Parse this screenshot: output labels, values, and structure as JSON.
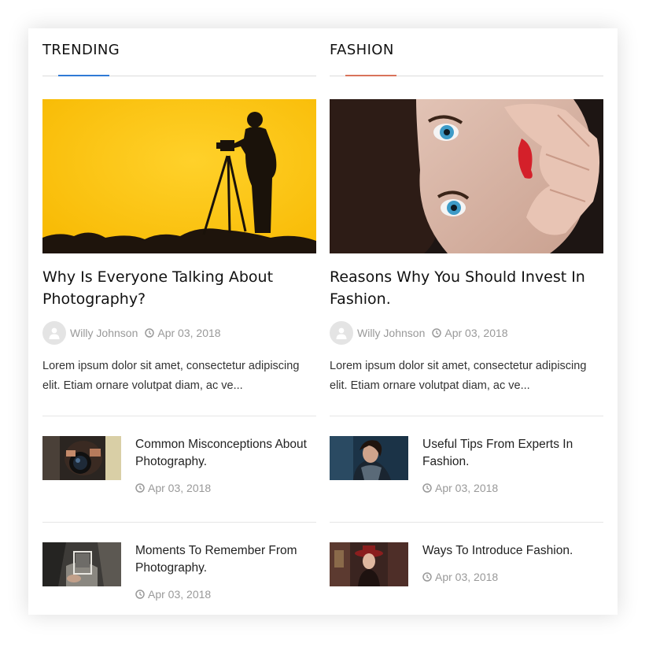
{
  "colors": {
    "trending_accent": "#2f7ad6",
    "fashion_accent": "#d9735a"
  },
  "sections": [
    {
      "title": "TRENDING",
      "featured": {
        "image": "photographer-silhouette-image",
        "title": "Why Is Everyone Talking About Photography?",
        "author": "Willy Johnson",
        "date": "Apr 03, 2018",
        "excerpt": "Lorem ipsum dolor sit amet, consectetur adipiscing elit. Etiam ornare volutpat diam, ac ve..."
      },
      "items": [
        {
          "image": "camera-lens-image",
          "title": "Common Misconceptions About Photography.",
          "date": "Apr 03, 2018"
        },
        {
          "image": "polaroid-cave-image",
          "title": "Moments To Remember From Photography.",
          "date": "Apr 03, 2018"
        }
      ]
    },
    {
      "title": "FASHION",
      "featured": {
        "image": "blue-eyed-woman-image",
        "title": "Reasons Why You Should Invest In Fashion.",
        "author": "Willy Johnson",
        "date": "Apr 03, 2018",
        "excerpt": "Lorem ipsum dolor sit amet, consectetur adipiscing elit. Etiam ornare volutpat diam, ac ve..."
      },
      "items": [
        {
          "image": "woman-winter-coat-image",
          "title": "Useful Tips From Experts In Fashion.",
          "date": "Apr 03, 2018"
        },
        {
          "image": "woman-red-hat-image",
          "title": "Ways To Introduce Fashion.",
          "date": "Apr 03, 2018"
        }
      ]
    }
  ]
}
